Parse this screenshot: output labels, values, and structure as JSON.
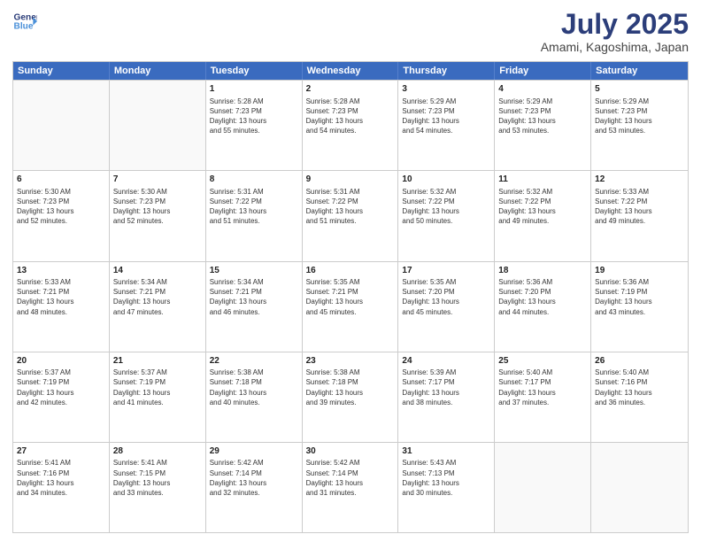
{
  "logo": {
    "line1": "General",
    "line2": "Blue",
    "icon": "▶"
  },
  "header": {
    "month": "July 2025",
    "location": "Amami, Kagoshima, Japan"
  },
  "days": [
    "Sunday",
    "Monday",
    "Tuesday",
    "Wednesday",
    "Thursday",
    "Friday",
    "Saturday"
  ],
  "rows": [
    [
      {
        "day": "",
        "details": ""
      },
      {
        "day": "",
        "details": ""
      },
      {
        "day": "1",
        "details": "Sunrise: 5:28 AM\nSunset: 7:23 PM\nDaylight: 13 hours\nand 55 minutes."
      },
      {
        "day": "2",
        "details": "Sunrise: 5:28 AM\nSunset: 7:23 PM\nDaylight: 13 hours\nand 54 minutes."
      },
      {
        "day": "3",
        "details": "Sunrise: 5:29 AM\nSunset: 7:23 PM\nDaylight: 13 hours\nand 54 minutes."
      },
      {
        "day": "4",
        "details": "Sunrise: 5:29 AM\nSunset: 7:23 PM\nDaylight: 13 hours\nand 53 minutes."
      },
      {
        "day": "5",
        "details": "Sunrise: 5:29 AM\nSunset: 7:23 PM\nDaylight: 13 hours\nand 53 minutes."
      }
    ],
    [
      {
        "day": "6",
        "details": "Sunrise: 5:30 AM\nSunset: 7:23 PM\nDaylight: 13 hours\nand 52 minutes."
      },
      {
        "day": "7",
        "details": "Sunrise: 5:30 AM\nSunset: 7:23 PM\nDaylight: 13 hours\nand 52 minutes."
      },
      {
        "day": "8",
        "details": "Sunrise: 5:31 AM\nSunset: 7:22 PM\nDaylight: 13 hours\nand 51 minutes."
      },
      {
        "day": "9",
        "details": "Sunrise: 5:31 AM\nSunset: 7:22 PM\nDaylight: 13 hours\nand 51 minutes."
      },
      {
        "day": "10",
        "details": "Sunrise: 5:32 AM\nSunset: 7:22 PM\nDaylight: 13 hours\nand 50 minutes."
      },
      {
        "day": "11",
        "details": "Sunrise: 5:32 AM\nSunset: 7:22 PM\nDaylight: 13 hours\nand 49 minutes."
      },
      {
        "day": "12",
        "details": "Sunrise: 5:33 AM\nSunset: 7:22 PM\nDaylight: 13 hours\nand 49 minutes."
      }
    ],
    [
      {
        "day": "13",
        "details": "Sunrise: 5:33 AM\nSunset: 7:21 PM\nDaylight: 13 hours\nand 48 minutes."
      },
      {
        "day": "14",
        "details": "Sunrise: 5:34 AM\nSunset: 7:21 PM\nDaylight: 13 hours\nand 47 minutes."
      },
      {
        "day": "15",
        "details": "Sunrise: 5:34 AM\nSunset: 7:21 PM\nDaylight: 13 hours\nand 46 minutes."
      },
      {
        "day": "16",
        "details": "Sunrise: 5:35 AM\nSunset: 7:21 PM\nDaylight: 13 hours\nand 45 minutes."
      },
      {
        "day": "17",
        "details": "Sunrise: 5:35 AM\nSunset: 7:20 PM\nDaylight: 13 hours\nand 45 minutes."
      },
      {
        "day": "18",
        "details": "Sunrise: 5:36 AM\nSunset: 7:20 PM\nDaylight: 13 hours\nand 44 minutes."
      },
      {
        "day": "19",
        "details": "Sunrise: 5:36 AM\nSunset: 7:19 PM\nDaylight: 13 hours\nand 43 minutes."
      }
    ],
    [
      {
        "day": "20",
        "details": "Sunrise: 5:37 AM\nSunset: 7:19 PM\nDaylight: 13 hours\nand 42 minutes."
      },
      {
        "day": "21",
        "details": "Sunrise: 5:37 AM\nSunset: 7:19 PM\nDaylight: 13 hours\nand 41 minutes."
      },
      {
        "day": "22",
        "details": "Sunrise: 5:38 AM\nSunset: 7:18 PM\nDaylight: 13 hours\nand 40 minutes."
      },
      {
        "day": "23",
        "details": "Sunrise: 5:38 AM\nSunset: 7:18 PM\nDaylight: 13 hours\nand 39 minutes."
      },
      {
        "day": "24",
        "details": "Sunrise: 5:39 AM\nSunset: 7:17 PM\nDaylight: 13 hours\nand 38 minutes."
      },
      {
        "day": "25",
        "details": "Sunrise: 5:40 AM\nSunset: 7:17 PM\nDaylight: 13 hours\nand 37 minutes."
      },
      {
        "day": "26",
        "details": "Sunrise: 5:40 AM\nSunset: 7:16 PM\nDaylight: 13 hours\nand 36 minutes."
      }
    ],
    [
      {
        "day": "27",
        "details": "Sunrise: 5:41 AM\nSunset: 7:16 PM\nDaylight: 13 hours\nand 34 minutes."
      },
      {
        "day": "28",
        "details": "Sunrise: 5:41 AM\nSunset: 7:15 PM\nDaylight: 13 hours\nand 33 minutes."
      },
      {
        "day": "29",
        "details": "Sunrise: 5:42 AM\nSunset: 7:14 PM\nDaylight: 13 hours\nand 32 minutes."
      },
      {
        "day": "30",
        "details": "Sunrise: 5:42 AM\nSunset: 7:14 PM\nDaylight: 13 hours\nand 31 minutes."
      },
      {
        "day": "31",
        "details": "Sunrise: 5:43 AM\nSunset: 7:13 PM\nDaylight: 13 hours\nand 30 minutes."
      },
      {
        "day": "",
        "details": ""
      },
      {
        "day": "",
        "details": ""
      }
    ]
  ]
}
